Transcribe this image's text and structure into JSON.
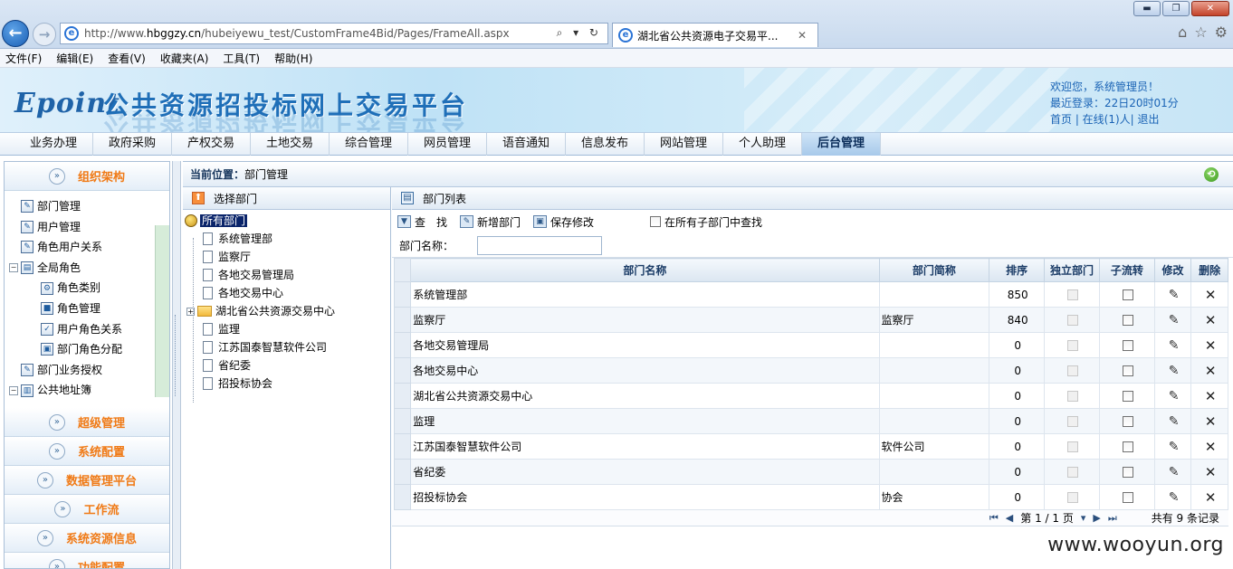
{
  "browser": {
    "url_prefix": "http://www.",
    "url_domain": "hbggzy.cn",
    "url_path": "/hubeiyewu_test/CustomFrame4Bid/Pages/FrameAll.aspx",
    "addr_tools": "⌕ ▾ ↻",
    "tab_title": "湖北省公共资源电子交易平...",
    "tab_close": "✕",
    "back": "←",
    "forward": "→",
    "home_icon": "⌂",
    "favorites_icon": "☆",
    "settings_icon": "⚙",
    "win_min": "▬",
    "win_max": "❐",
    "win_close": "✕",
    "menu": [
      "文件(F)",
      "编辑(E)",
      "查看(V)",
      "收藏夹(A)",
      "工具(T)",
      "帮助(H)"
    ]
  },
  "header": {
    "logo": "Epoint",
    "title": "公共资源招投标网上交易平台",
    "welcome": "欢迎您，系统管理员！",
    "last_login": "最近登录：22日20时01分",
    "links": "首页 | 在线(1)人| 退出"
  },
  "nav": {
    "tabs": [
      "业务办理",
      "政府采购",
      "产权交易",
      "土地交易",
      "综合管理",
      "网员管理",
      "语音通知",
      "信息发布",
      "网站管理",
      "个人助理",
      "后台管理"
    ],
    "active": "后台管理"
  },
  "sidebar": {
    "open_section": "组织架构",
    "tree": [
      {
        "label": "部门管理",
        "level": 0
      },
      {
        "label": "用户管理",
        "level": 0
      },
      {
        "label": "角色用户关系",
        "level": 0
      },
      {
        "label": "全局角色",
        "level": 0,
        "expand": "⊟"
      },
      {
        "label": "角色类别",
        "level": 1
      },
      {
        "label": "角色管理",
        "level": 1
      },
      {
        "label": "用户角色关系",
        "level": 1
      },
      {
        "label": "部门角色分配",
        "level": 1
      },
      {
        "label": "部门业务授权",
        "level": 0
      },
      {
        "label": "公共地址簿",
        "level": 0,
        "expand": "⊟"
      }
    ],
    "sections": [
      "超级管理",
      "系统配置",
      "数据管理平台",
      "工作流",
      "系统资源信息",
      "功能配置"
    ],
    "toggle_glyph": "»"
  },
  "main": {
    "crumb_label": "当前位置：",
    "crumb_value": "部门管理",
    "back_glyph": "⟲"
  },
  "dept_panel": {
    "title": "选择部门",
    "root": "所有部门",
    "nodes": [
      "系统管理部",
      "监察厅",
      "各地交易管理局",
      "各地交易中心",
      "湖北省公共资源交易中心",
      "监理",
      "江苏国泰智慧软件公司",
      "省纪委",
      "招投标协会"
    ]
  },
  "list_panel": {
    "title": "部门列表",
    "search_btn": "查　找",
    "add_btn": "新增部门",
    "save_btn": "保存修改",
    "subdept_label": "在所有子部门中查找",
    "name_label": "部门名称：",
    "name_value": "",
    "columns": [
      "部门名称",
      "部门简称",
      "排序",
      "独立部门",
      "子流转",
      "修改",
      "删除"
    ],
    "rows": [
      {
        "name": "系统管理部",
        "short": "",
        "order": "850"
      },
      {
        "name": "监察厅",
        "short": "监察厅",
        "order": "840"
      },
      {
        "name": "各地交易管理局",
        "short": "",
        "order": "0"
      },
      {
        "name": "各地交易中心",
        "short": "",
        "order": "0"
      },
      {
        "name": "湖北省公共资源交易中心",
        "short": "",
        "order": "0"
      },
      {
        "name": "监理",
        "short": "",
        "order": "0"
      },
      {
        "name": "江苏国泰智慧软件公司",
        "short": "软件公司",
        "order": "0"
      },
      {
        "name": "省纪委",
        "short": "",
        "order": "0"
      },
      {
        "name": "招投标协会",
        "short": "协会",
        "order": "0"
      }
    ],
    "pager": {
      "first": "⏮",
      "prev": "◀",
      "page_text": "第 1 / 1 页",
      "dropdown": "▾",
      "next": "▶",
      "last": "⏭",
      "total": "共有 9 条记录"
    }
  },
  "watermark": "www.wooyun.org"
}
